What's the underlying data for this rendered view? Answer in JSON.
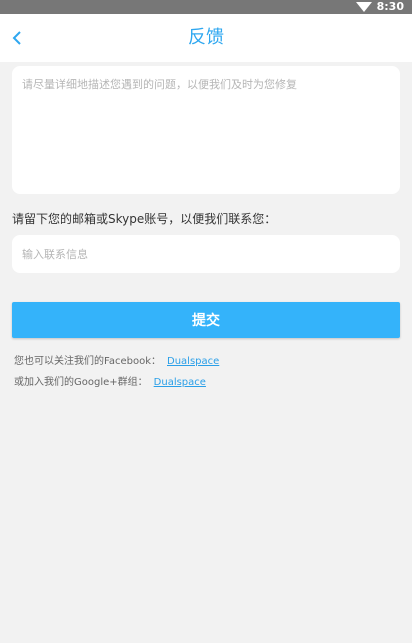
{
  "status_bar": {
    "time": "8:30",
    "wifi_icon": "wifi-icon"
  },
  "header": {
    "title": "反馈",
    "back_icon": "chevron-left-icon"
  },
  "feedback": {
    "placeholder": "请尽量详细地描述您遇到的问题，以便我们及时为您修复"
  },
  "contact": {
    "label": "请留下您的邮箱或Skype账号，以便我们联系您：",
    "placeholder": "输入联系信息"
  },
  "submit": {
    "label": "提交"
  },
  "social": {
    "facebook_text": "您也可以关注我们的Facebook：",
    "facebook_link": "Dualspace",
    "google_text": "或加入我们的Google+群组：",
    "google_link": "Dualspace"
  },
  "colors": {
    "accent": "#2ea7f0",
    "button": "#34b3fa",
    "background": "#f2f2f2"
  }
}
